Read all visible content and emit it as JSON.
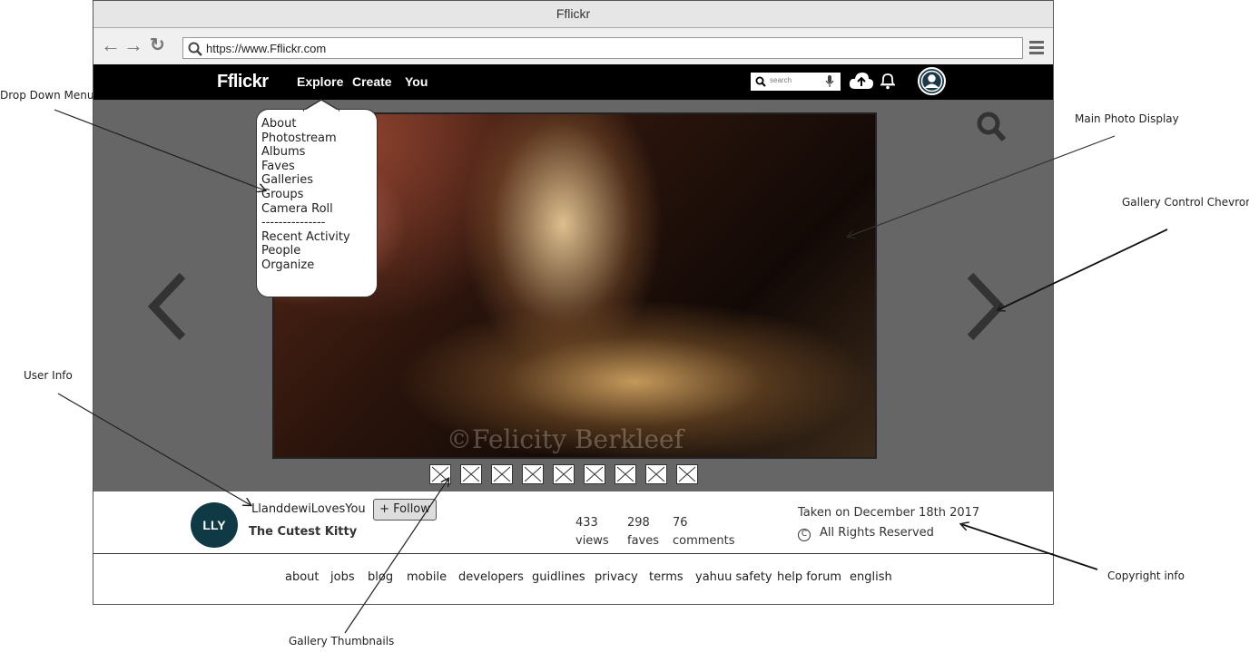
{
  "browser": {
    "title": "Fflickr",
    "url": "https://www.Fflickr.com"
  },
  "topnav": {
    "logo": "Fflickr",
    "links": [
      "Explore",
      "Create",
      "You"
    ],
    "search_placeholder": "search"
  },
  "dropdown": {
    "items": [
      "About",
      "Photostream",
      "Albums",
      "Faves",
      "Galleries",
      "Groups",
      "Camera Roll",
      "---------------",
      "Recent Activity",
      "People",
      "Organize"
    ]
  },
  "photo": {
    "watermark": "©Felicity Berkleef"
  },
  "thumbnails": {
    "count": 9
  },
  "info": {
    "avatar_initials": "LLY",
    "username": "LlanddewiLovesYou",
    "title": "The Cutest Kitty",
    "follow_label": "+ Follow",
    "stats": [
      {
        "value": "433",
        "label": "views"
      },
      {
        "value": "298",
        "label": "faves"
      },
      {
        "value": "76",
        "label": "comments"
      }
    ],
    "taken": "Taken on December 18th 2017",
    "rights": "All Rights Reserved"
  },
  "footer": {
    "links": [
      "about",
      "jobs",
      "blog",
      "mobile",
      "developers",
      "guidlines",
      "privacy",
      "terms",
      "yahuu safety",
      "help forum",
      "english"
    ]
  },
  "annotations": {
    "dropdown": "Drop Down Menu",
    "main_photo": "Main Photo Display",
    "chevron": "Gallery Control Chevron",
    "user_info": "User Info",
    "copyright": "Copyright info",
    "thumbnails": "Gallery Thumbnails"
  },
  "colors": {
    "nav_bg": "#000000",
    "stage_bg": "#666666",
    "avatar_bg": "#0f3a45"
  }
}
